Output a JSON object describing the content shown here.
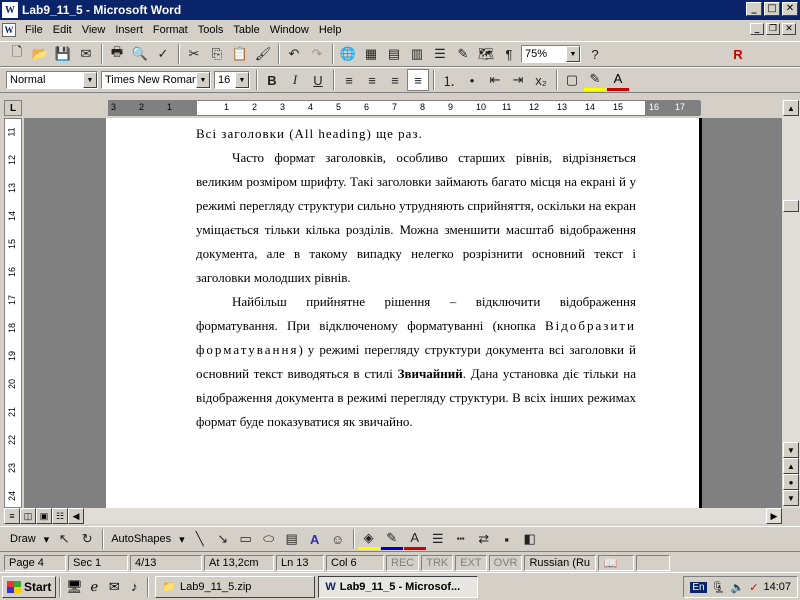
{
  "window": {
    "title": "Lab9_11_5 - Microsoft Word",
    "app_icon": "W"
  },
  "menu": [
    "File",
    "Edit",
    "View",
    "Insert",
    "Format",
    "Tools",
    "Table",
    "Window",
    "Help"
  ],
  "toolbar": {
    "zoom": "75%",
    "style": "Normal",
    "font": "Times New Roman",
    "size": "16"
  },
  "ruler": {
    "h_numbers": [
      "3",
      "2",
      "1",
      "1",
      "2",
      "3",
      "4",
      "5",
      "6",
      "7",
      "8",
      "9",
      "10",
      "11",
      "12",
      "13",
      "14",
      "15",
      "16",
      "17"
    ],
    "v_numbers": [
      "11",
      "12",
      "13",
      "14",
      "15",
      "16",
      "17",
      "18",
      "19",
      "20",
      "21",
      "22",
      "23",
      "24"
    ]
  },
  "document": {
    "line1": "Всі заголовки (All heading) ще раз.",
    "para1": "Часто формат заголовків, особливо старших рівнів, відрізняється великим розміром шрифту. Такі заголовки займають багато місця на екрані й у режимі перегляду структури сильно утрудняють сприйняття, оскільки на екран уміщається тільки кілька розділів. Можна зменшити масштаб відображення документа, але в такому випадку нелегко розрізнити основний текст і заголовки молодших рівнів.",
    "para2_a": "Найбільш прийнятне рішення – відключити відображення форматування. При відключеному форматуванні (кнопка ",
    "para2_spaced": "Відобразити форматування",
    "para2_b": ") у режимі перегляду структури документа всі заголовки й основний текст виводяться в стилі ",
    "para2_bold": "Звичайний",
    "para2_c": ". Дана установка діє тільки на відображення документа в режимі перегляду структури. В всіх інших режимах формат буде показуватися як звичайно."
  },
  "drawing": {
    "draw": "Draw",
    "autoshapes": "AutoShapes"
  },
  "status": {
    "page": "Page  4",
    "sec": "Sec  1",
    "pages": "4/13",
    "at": "At  13,2cm",
    "ln": "Ln  13",
    "col": "Col  6",
    "rec": "REC",
    "trk": "TRK",
    "ext": "EXT",
    "ovr": "OVR",
    "lang": "Russian (Ru"
  },
  "taskbar": {
    "start": "Start",
    "task1": "Lab9_11_5.zip",
    "task2": "Lab9_11_5 - Microsof...",
    "lang": "En",
    "clock": "14:07"
  }
}
